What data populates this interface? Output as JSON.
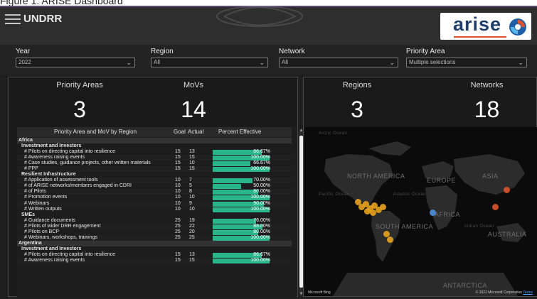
{
  "caption": "Figure 1: ARISE Dashboard",
  "header": {
    "brand": "UNDRR",
    "logo_text": "arise"
  },
  "filters": [
    {
      "label": "Year",
      "value": "2022"
    },
    {
      "label": "Region",
      "value": "All"
    },
    {
      "label": "Network",
      "value": "All"
    },
    {
      "label": "Priority Area",
      "value": "Multiple selections"
    }
  ],
  "left_panel": {
    "kpis": [
      {
        "label": "Priority Areas",
        "value": "3"
      },
      {
        "label": "MoVs",
        "value": "14"
      }
    ],
    "table": {
      "headers": [
        "Priority Area and MoV by Region",
        "Goal",
        "Actual",
        "Percent Effective"
      ],
      "rows": [
        {
          "type": "region",
          "name": "Africa"
        },
        {
          "type": "cat",
          "name": "Investment and Investors"
        },
        {
          "type": "metric",
          "name": "# Pilots on directing capital into resilience",
          "goal": "15",
          "actual": "13",
          "pct": "86.67%",
          "pct_value": 86.67
        },
        {
          "type": "metric",
          "name": "# Awareness raising events",
          "goal": "15",
          "actual": "15",
          "pct": "100.00%",
          "pct_value": 100
        },
        {
          "type": "metric",
          "name": "# Case studies, guidance projects, other written materials",
          "goal": "15",
          "actual": "10",
          "pct": "66.67%",
          "pct_value": 66.67
        },
        {
          "type": "metric",
          "name": "# PPP",
          "goal": "15",
          "actual": "15",
          "pct": "100.00%",
          "pct_value": 100
        },
        {
          "type": "cat",
          "name": "Resilient Infrastructure"
        },
        {
          "type": "metric",
          "name": "# Application of assessment tools",
          "goal": "10",
          "actual": "7",
          "pct": "70.00%",
          "pct_value": 70
        },
        {
          "type": "metric",
          "name": "# of ARISE networks/members engaged in CDRI",
          "goal": "10",
          "actual": "5",
          "pct": "50.00%",
          "pct_value": 50
        },
        {
          "type": "metric",
          "name": "# of Pilots",
          "goal": "10",
          "actual": "8",
          "pct": "80.00%",
          "pct_value": 80
        },
        {
          "type": "metric",
          "name": "# Promotion events",
          "goal": "10",
          "actual": "10",
          "pct": "100.00%",
          "pct_value": 100
        },
        {
          "type": "metric",
          "name": "# Webinars",
          "goal": "10",
          "actual": "9",
          "pct": "90.00%",
          "pct_value": 90
        },
        {
          "type": "metric",
          "name": "# Written outputs",
          "goal": "10",
          "actual": "10",
          "pct": "100.00%",
          "pct_value": 100
        },
        {
          "type": "cat",
          "name": "SMEs"
        },
        {
          "type": "metric",
          "name": "# Guidance documents",
          "goal": "25",
          "actual": "19",
          "pct": "76.00%",
          "pct_value": 76
        },
        {
          "type": "metric",
          "name": "# Pilots of wider DRR engagement",
          "goal": "25",
          "actual": "22",
          "pct": "88.00%",
          "pct_value": 88
        },
        {
          "type": "metric",
          "name": "# Pilots on BCP",
          "goal": "25",
          "actual": "20",
          "pct": "80.00%",
          "pct_value": 80
        },
        {
          "type": "metric",
          "name": "# Webinars, workshops, trainings",
          "goal": "25",
          "actual": "25",
          "pct": "100.00%",
          "pct_value": 100
        },
        {
          "type": "region",
          "name": "Argentina"
        },
        {
          "type": "cat",
          "name": "Investment and Investors"
        },
        {
          "type": "metric",
          "name": "# Pilots on directing capital into resilience",
          "goal": "15",
          "actual": "13",
          "pct": "86.67%",
          "pct_value": 86.67
        },
        {
          "type": "metric",
          "name": "# Awareness raising events",
          "goal": "15",
          "actual": "15",
          "pct": "100.00%",
          "pct_value": 100
        }
      ]
    }
  },
  "right_panel": {
    "kpis": [
      {
        "label": "Regions",
        "value": "3"
      },
      {
        "label": "Networks",
        "value": "18"
      }
    ],
    "map": {
      "labels": [
        "NORTH AMERICA",
        "EUROPE",
        "ASIA",
        "AFRICA",
        "SOUTH AMERICA",
        "AUSTRALIA",
        "ANTARCTICA"
      ],
      "ocean_labels": [
        "Arctic Ocean",
        "Pacific Ocean",
        "Atlantic Ocean",
        "Indian Ocean"
      ],
      "footer_left": "Microsoft Bing",
      "footer_right": "© 2022 Microsoft Corporation",
      "terms": "Terms",
      "marker_colors": {
        "americas": "#e8a21e",
        "africa": "#4a90d9",
        "asia": "#d9542b"
      }
    }
  }
}
